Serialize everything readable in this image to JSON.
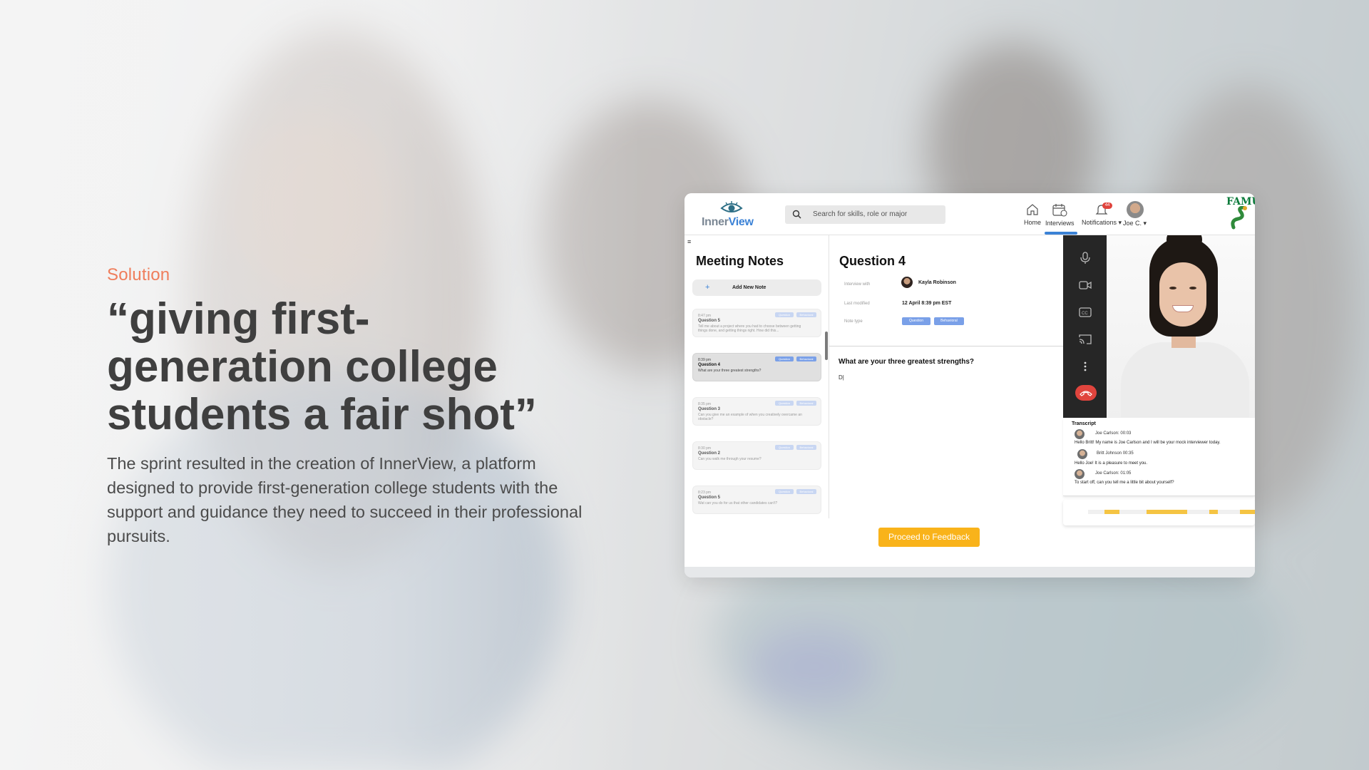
{
  "hero": {
    "eyebrow": "Solution",
    "headline": "“giving first-generation college students a fair shot”",
    "body": "The sprint resulted in the creation of InnerView, a platform designed to provide first-generation college students with the support and guidance they need to succeed in their professional pursuits."
  },
  "app": {
    "logo": {
      "part1": "Inner",
      "part2": "View"
    },
    "search": {
      "placeholder": "Search for skills, role or major"
    },
    "nav": {
      "home": "Home",
      "interviews": "Interviews",
      "notifications": "Notifications",
      "notification_count": "44",
      "user": "Joe C."
    },
    "partner_logo_text": "FAMU",
    "notes": {
      "title": "Meeting Notes",
      "add_label": "Add New Note",
      "cards": [
        {
          "time": "8:47 pm",
          "title": "Question 5",
          "desc": "Tell me about a project where you had to choose between getting things done, and getting things right. How did this...",
          "active": false
        },
        {
          "time": "8:39 pm",
          "title": "Question 4",
          "desc": "What are your three greatest strengths?",
          "active": true
        },
        {
          "time": "8:35 pm",
          "title": "Question 3",
          "desc": "Can you give me an example of when you creatively overcame an obstacle?",
          "active": false
        },
        {
          "time": "8:30 pm",
          "title": "Question 2",
          "desc": "Can you walk me through your resume?",
          "active": false
        },
        {
          "time": "8:23 pm",
          "title": "Question 5",
          "desc": "Wat can you do for us that other candidates can't?",
          "active": false
        }
      ],
      "tags": [
        "Question",
        "Behavioral"
      ]
    },
    "question": {
      "title": "Question 4",
      "interview_with_label": "Interview with",
      "interview_with": "Kayla Robinson",
      "last_modified_label": "Last modified",
      "last_modified": "12 April 8:39 pm EST",
      "note_type_label": "Note type",
      "tags": [
        "Question",
        "Behavioral"
      ],
      "prompt": "What are your three greatest strengths?",
      "answer": "D|"
    },
    "transcript": {
      "title": "Transcript",
      "entries": [
        {
          "name": "Joe Carlson",
          "time": "00:03",
          "msg": "Hello Britt! My name is Joe Carlson and I will be your mock interviewer today."
        },
        {
          "name": "Britt Johnson",
          "time": "00:35",
          "msg": "Hello Joe! It is a pleasure to meet you."
        },
        {
          "name": "Joe Carlson",
          "time": "01:05",
          "msg": "To start off, can you tell me a little bit about yourself?"
        }
      ]
    },
    "proceed_label": "Proceed to Feedback",
    "colors": {
      "accent": "#3b82d6",
      "cta": "#f9b31a",
      "eyebrow": "#ef7d5b",
      "hangup": "#e0443d"
    }
  }
}
